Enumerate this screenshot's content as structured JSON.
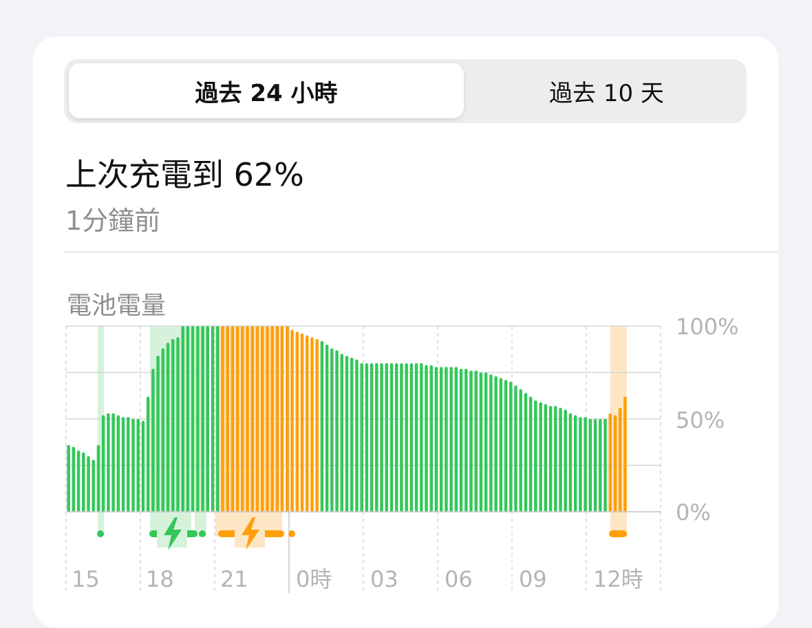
{
  "segments": {
    "tab_24h": "過去 24 小時",
    "tab_10d": "過去 10 天"
  },
  "summary": {
    "title": "上次充電到 62%",
    "subtitle": "1分鐘前"
  },
  "colors": {
    "green": "#34c759",
    "orange": "#ff9f0a",
    "green_band": "#d6f2dc",
    "orange_band": "#fde6c4",
    "grid": "#d6d6da",
    "label": "#b3b3b8"
  },
  "chart_data": {
    "type": "bar",
    "title": "電池電量",
    "y_ticks": [
      "100%",
      "50%",
      "0%"
    ],
    "ylim": [
      0,
      100
    ],
    "x_ticks": [
      "15",
      "18",
      "21",
      "0時",
      "03",
      "06",
      "09",
      "12時"
    ],
    "series": [
      {
        "values": [
          36,
          35,
          33,
          32,
          30,
          28,
          36,
          52,
          53,
          53,
          52,
          51,
          51,
          50,
          50,
          49,
          62,
          77,
          84,
          88,
          91,
          93,
          94,
          100,
          100,
          100,
          100,
          100,
          100,
          100,
          100,
          100,
          100,
          100,
          100,
          100,
          100,
          100,
          100,
          100,
          100,
          100,
          100,
          100,
          100,
          98,
          97,
          96,
          95,
          94,
          93,
          92,
          90,
          88,
          87,
          85,
          84,
          83,
          82,
          80,
          80,
          80,
          80,
          80,
          80,
          80,
          80,
          80,
          80,
          80,
          80,
          80,
          79,
          79,
          78,
          78,
          78,
          78,
          78,
          77,
          77,
          76,
          76,
          75,
          75,
          74,
          73,
          72,
          71,
          70,
          68,
          66,
          64,
          62,
          60,
          59,
          58,
          57,
          57,
          56,
          55,
          53,
          52,
          51,
          51,
          50,
          50,
          50,
          50,
          53,
          52,
          56,
          62
        ],
        "status": [
          "g",
          "g",
          "g",
          "g",
          "g",
          "g",
          "g",
          "g",
          "g",
          "g",
          "g",
          "g",
          "g",
          "g",
          "g",
          "g",
          "g",
          "g",
          "g",
          "g",
          "g",
          "g",
          "g",
          "g",
          "g",
          "g",
          "g",
          "g",
          "g",
          "g",
          "g",
          "o",
          "o",
          "o",
          "o",
          "o",
          "o",
          "o",
          "o",
          "o",
          "o",
          "o",
          "o",
          "o",
          "o",
          "o",
          "o",
          "o",
          "o",
          "o",
          "o",
          "g",
          "g",
          "g",
          "g",
          "g",
          "g",
          "g",
          "g",
          "g",
          "g",
          "g",
          "g",
          "g",
          "g",
          "g",
          "g",
          "g",
          "g",
          "g",
          "g",
          "g",
          "g",
          "g",
          "g",
          "g",
          "g",
          "g",
          "g",
          "g",
          "g",
          "g",
          "g",
          "g",
          "g",
          "g",
          "g",
          "g",
          "g",
          "g",
          "g",
          "g",
          "g",
          "g",
          "g",
          "g",
          "g",
          "g",
          "g",
          "g",
          "g",
          "g",
          "g",
          "g",
          "g",
          "g",
          "g",
          "g",
          "g",
          "o",
          "o",
          "o",
          "o"
        ]
      }
    ],
    "charging_events": [
      {
        "color": "green",
        "bolt": false
      },
      {
        "color": "green",
        "bolt": true
      },
      {
        "color": "green",
        "bolt": false
      },
      {
        "color": "orange",
        "bolt": true
      },
      {
        "color": "orange",
        "bolt": false
      },
      {
        "color": "orange",
        "bolt": false
      }
    ]
  }
}
